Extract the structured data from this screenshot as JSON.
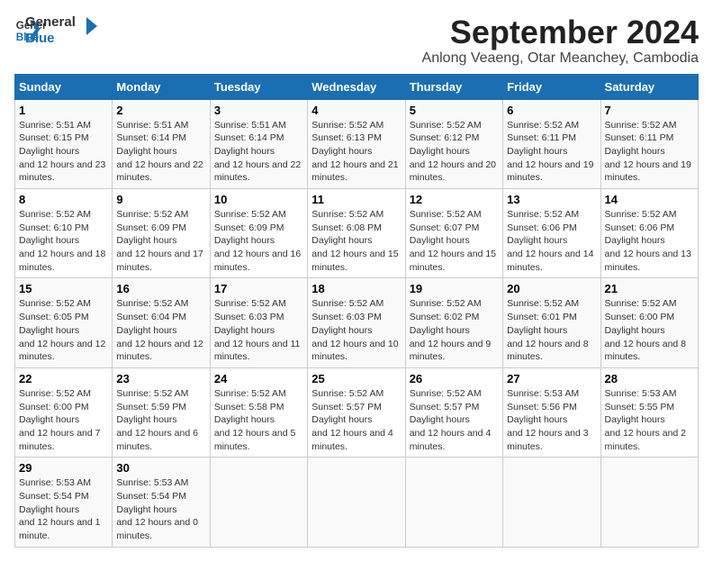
{
  "header": {
    "logo_line1": "General",
    "logo_line2": "Blue",
    "month": "September 2024",
    "location": "Anlong Veaeng, Otar Meanchey, Cambodia"
  },
  "weekdays": [
    "Sunday",
    "Monday",
    "Tuesday",
    "Wednesday",
    "Thursday",
    "Friday",
    "Saturday"
  ],
  "weeks": [
    [
      {
        "day": "1",
        "sunrise": "5:51 AM",
        "sunset": "6:15 PM",
        "daylight": "12 hours and 23 minutes."
      },
      {
        "day": "2",
        "sunrise": "5:51 AM",
        "sunset": "6:14 PM",
        "daylight": "12 hours and 22 minutes."
      },
      {
        "day": "3",
        "sunrise": "5:51 AM",
        "sunset": "6:14 PM",
        "daylight": "12 hours and 22 minutes."
      },
      {
        "day": "4",
        "sunrise": "5:52 AM",
        "sunset": "6:13 PM",
        "daylight": "12 hours and 21 minutes."
      },
      {
        "day": "5",
        "sunrise": "5:52 AM",
        "sunset": "6:12 PM",
        "daylight": "12 hours and 20 minutes."
      },
      {
        "day": "6",
        "sunrise": "5:52 AM",
        "sunset": "6:11 PM",
        "daylight": "12 hours and 19 minutes."
      },
      {
        "day": "7",
        "sunrise": "5:52 AM",
        "sunset": "6:11 PM",
        "daylight": "12 hours and 19 minutes."
      }
    ],
    [
      {
        "day": "8",
        "sunrise": "5:52 AM",
        "sunset": "6:10 PM",
        "daylight": "12 hours and 18 minutes."
      },
      {
        "day": "9",
        "sunrise": "5:52 AM",
        "sunset": "6:09 PM",
        "daylight": "12 hours and 17 minutes."
      },
      {
        "day": "10",
        "sunrise": "5:52 AM",
        "sunset": "6:09 PM",
        "daylight": "12 hours and 16 minutes."
      },
      {
        "day": "11",
        "sunrise": "5:52 AM",
        "sunset": "6:08 PM",
        "daylight": "12 hours and 15 minutes."
      },
      {
        "day": "12",
        "sunrise": "5:52 AM",
        "sunset": "6:07 PM",
        "daylight": "12 hours and 15 minutes."
      },
      {
        "day": "13",
        "sunrise": "5:52 AM",
        "sunset": "6:06 PM",
        "daylight": "12 hours and 14 minutes."
      },
      {
        "day": "14",
        "sunrise": "5:52 AM",
        "sunset": "6:06 PM",
        "daylight": "12 hours and 13 minutes."
      }
    ],
    [
      {
        "day": "15",
        "sunrise": "5:52 AM",
        "sunset": "6:05 PM",
        "daylight": "12 hours and 12 minutes."
      },
      {
        "day": "16",
        "sunrise": "5:52 AM",
        "sunset": "6:04 PM",
        "daylight": "12 hours and 12 minutes."
      },
      {
        "day": "17",
        "sunrise": "5:52 AM",
        "sunset": "6:03 PM",
        "daylight": "12 hours and 11 minutes."
      },
      {
        "day": "18",
        "sunrise": "5:52 AM",
        "sunset": "6:03 PM",
        "daylight": "12 hours and 10 minutes."
      },
      {
        "day": "19",
        "sunrise": "5:52 AM",
        "sunset": "6:02 PM",
        "daylight": "12 hours and 9 minutes."
      },
      {
        "day": "20",
        "sunrise": "5:52 AM",
        "sunset": "6:01 PM",
        "daylight": "12 hours and 8 minutes."
      },
      {
        "day": "21",
        "sunrise": "5:52 AM",
        "sunset": "6:00 PM",
        "daylight": "12 hours and 8 minutes."
      }
    ],
    [
      {
        "day": "22",
        "sunrise": "5:52 AM",
        "sunset": "6:00 PM",
        "daylight": "12 hours and 7 minutes."
      },
      {
        "day": "23",
        "sunrise": "5:52 AM",
        "sunset": "5:59 PM",
        "daylight": "12 hours and 6 minutes."
      },
      {
        "day": "24",
        "sunrise": "5:52 AM",
        "sunset": "5:58 PM",
        "daylight": "12 hours and 5 minutes."
      },
      {
        "day": "25",
        "sunrise": "5:52 AM",
        "sunset": "5:57 PM",
        "daylight": "12 hours and 4 minutes."
      },
      {
        "day": "26",
        "sunrise": "5:52 AM",
        "sunset": "5:57 PM",
        "daylight": "12 hours and 4 minutes."
      },
      {
        "day": "27",
        "sunrise": "5:53 AM",
        "sunset": "5:56 PM",
        "daylight": "12 hours and 3 minutes."
      },
      {
        "day": "28",
        "sunrise": "5:53 AM",
        "sunset": "5:55 PM",
        "daylight": "12 hours and 2 minutes."
      }
    ],
    [
      {
        "day": "29",
        "sunrise": "5:53 AM",
        "sunset": "5:54 PM",
        "daylight": "12 hours and 1 minute."
      },
      {
        "day": "30",
        "sunrise": "5:53 AM",
        "sunset": "5:54 PM",
        "daylight": "12 hours and 0 minutes."
      },
      null,
      null,
      null,
      null,
      null
    ]
  ]
}
